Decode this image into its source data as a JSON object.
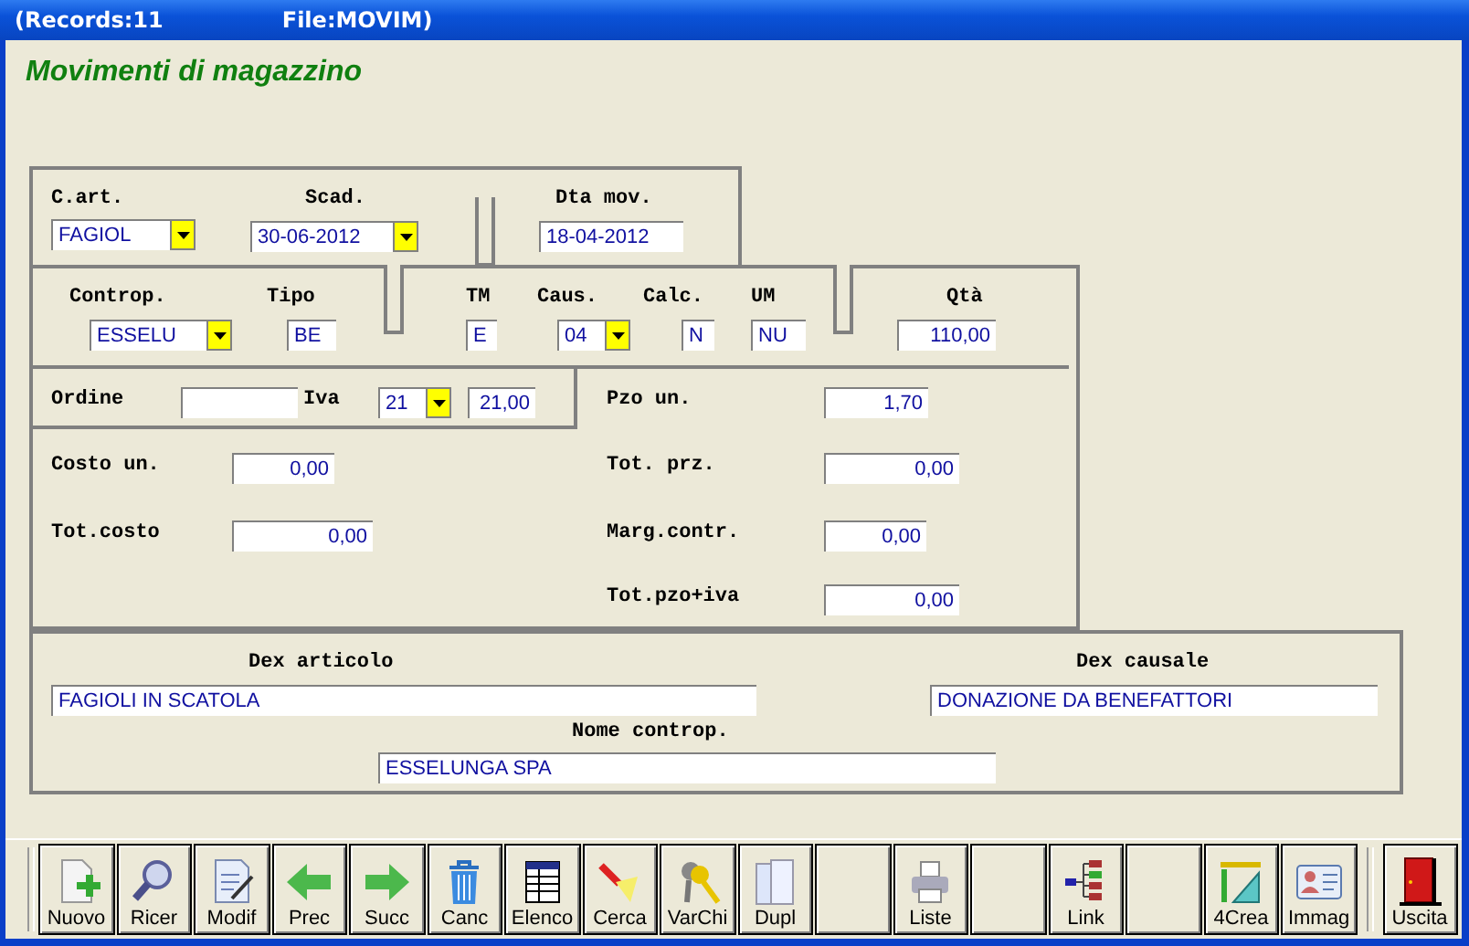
{
  "window": {
    "records": "(Records:11",
    "file": "File:MOVIM)"
  },
  "heading": "Movimenti di magazzino",
  "fields": [
    {
      "label": "C.art.",
      "value": "FAGIOL",
      "dropdown": true
    },
    {
      "label": "Scad.",
      "value": "30-06-2012",
      "dropdown": true
    },
    {
      "label": "Dta mov.",
      "value": "18-04-2012",
      "dropdown": false
    },
    {
      "label": "Controp.",
      "value": "ESSELU",
      "dropdown": true
    },
    {
      "label": "Tipo",
      "value": "BE",
      "dropdown": false
    },
    {
      "label": "TM",
      "value": "E",
      "dropdown": false
    },
    {
      "label": "Caus.",
      "value": "04",
      "dropdown": true
    },
    {
      "label": "Calc.",
      "value": "N",
      "dropdown": false
    },
    {
      "label": "UM",
      "value": "NU",
      "dropdown": false
    },
    {
      "label": "Qtà",
      "value": "110,00",
      "dropdown": false
    },
    {
      "label": "Ordine",
      "dropdown": false
    },
    {
      "label": "Iva",
      "value": "21",
      "dropdown": true
    },
    {
      "value": "21,00",
      "dropdown": false
    },
    {
      "label": "Pzo un.",
      "value": "1,70",
      "dropdown": false
    },
    {
      "label": "Costo un.",
      "value": "0,00",
      "dropdown": false
    },
    {
      "label": "Tot. prz.",
      "value": "0,00",
      "dropdown": false
    },
    {
      "label": "Tot.costo",
      "value": "0,00",
      "dropdown": false
    },
    {
      "label": "Marg.contr.",
      "value": "0,00",
      "dropdown": false
    },
    {
      "label": "Tot.pzo+iva",
      "value": "0,00",
      "dropdown": false
    },
    {
      "label": "Dex articolo",
      "value": "FAGIOLI IN SCATOLA",
      "dropdown": false
    },
    {
      "label": "Dex causale",
      "value": "DONAZIONE DA BENEFATTORI",
      "dropdown": false
    },
    {
      "label": "Nome controp.",
      "value": "ESSELUNGA SPA",
      "dropdown": false
    }
  ],
  "toolbar": [
    {
      "kind": "new",
      "label": "Nuovo"
    },
    {
      "kind": "search",
      "label": "Ricer"
    },
    {
      "kind": "edit",
      "label": "Modif"
    },
    {
      "kind": "prev",
      "label": "Prec"
    },
    {
      "kind": "next",
      "label": "Succ"
    },
    {
      "kind": "delete",
      "label": "Canc"
    },
    {
      "kind": "list",
      "label": "Elenco"
    },
    {
      "kind": "find",
      "label": "Cerca"
    },
    {
      "kind": "keys",
      "label": "VarChi"
    },
    {
      "kind": "copy",
      "label": "Dupl"
    },
    {
      "kind": "blank"
    },
    {
      "kind": "print",
      "label": "Liste"
    },
    {
      "kind": "blank"
    },
    {
      "kind": "link",
      "label": "Link"
    },
    {
      "kind": "blank"
    },
    {
      "kind": "create",
      "label": "4Crea"
    },
    {
      "kind": "image",
      "label": "Immag"
    }
  ],
  "exit_button": {
    "label": "Uscita"
  }
}
